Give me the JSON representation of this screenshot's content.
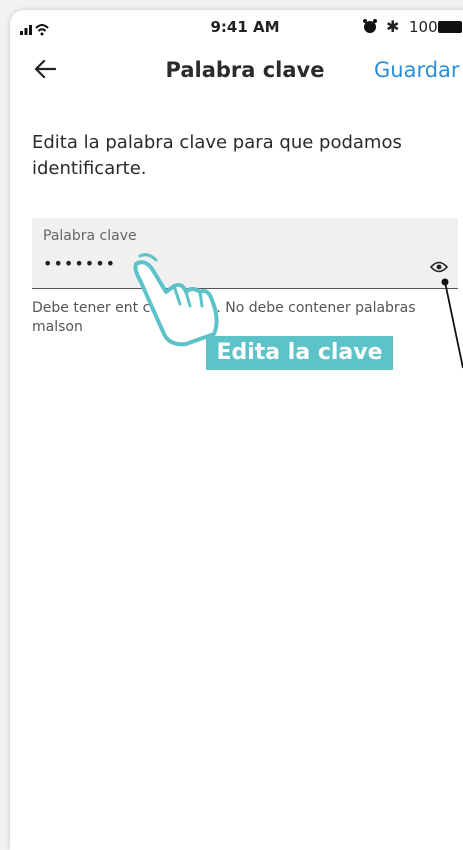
{
  "status_bar": {
    "time": "9:41 AM",
    "battery": "100"
  },
  "nav": {
    "title": "Palabra clave",
    "save_label": "Guardar"
  },
  "intro_text": "Edita la palabra clave para que podamos identificarte.",
  "field": {
    "label": "Palabra clave",
    "value": "•••••••"
  },
  "helper_text": "Debe tener ent          caracteres. No debe contener palabras malson",
  "callout": "Edita la clave",
  "icons": [
    "signal-icon",
    "wifi-icon",
    "alarm-icon",
    "bluetooth-icon",
    "battery-icon",
    "back-arrow-icon",
    "eye-icon",
    "hand-pointer-icon"
  ],
  "colors": {
    "accent": "#2a8fd8",
    "callout": "#5cc3c8"
  }
}
